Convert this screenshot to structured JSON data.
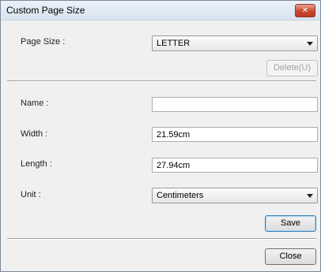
{
  "window": {
    "title": "Custom Page Size",
    "close_glyph": "✕"
  },
  "page_size": {
    "label": "Page Size :",
    "selected": "LETTER"
  },
  "delete_button": {
    "label": "Delete(U)"
  },
  "name_field": {
    "label": "Name :",
    "value": ""
  },
  "width_field": {
    "label": "Width :",
    "value": "21.59cm"
  },
  "length_field": {
    "label": "Length :",
    "value": "27.94cm"
  },
  "unit": {
    "label": "Unit :",
    "selected": "Centimeters"
  },
  "save_button": {
    "label": "Save"
  },
  "close_button": {
    "label": "Close"
  }
}
